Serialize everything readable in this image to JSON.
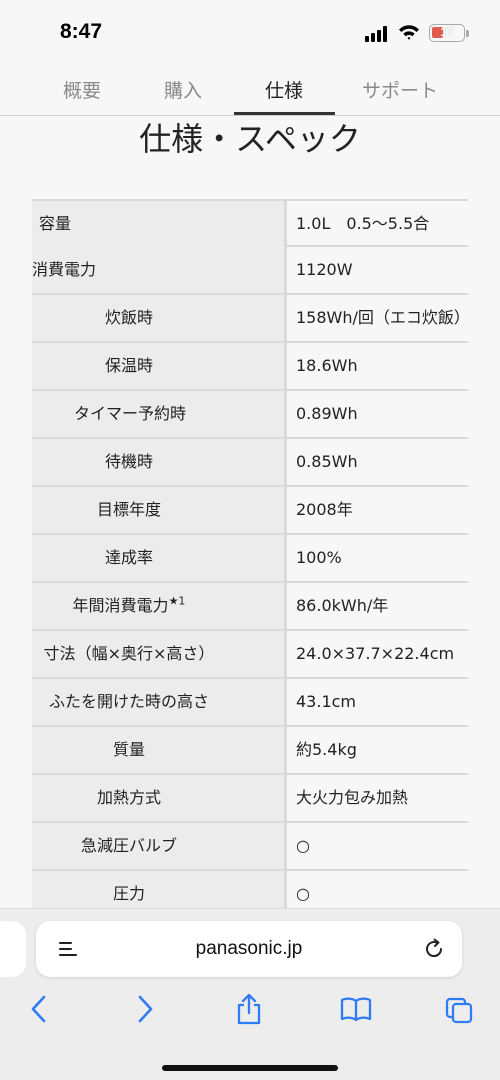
{
  "status_bar": {
    "time": "8:47",
    "battery": "17"
  },
  "tabs": [
    {
      "label": "概要",
      "active": false
    },
    {
      "label": "購入",
      "active": false
    },
    {
      "label": "仕様",
      "active": true
    },
    {
      "label": "サポート",
      "active": false
    }
  ],
  "page_title": "仕様・スペック",
  "spec_rows": [
    {
      "label": "容量",
      "value": "1.0L　0.5〜5.5合"
    },
    {
      "label": "消費電力",
      "value": "1120W"
    },
    {
      "label": "炊飯時",
      "value": "158Wh/回（エコ炊飯）"
    },
    {
      "label": "保温時",
      "value": "18.6Wh"
    },
    {
      "label": "タイマー予約時",
      "value": "0.89Wh"
    },
    {
      "label": "待機時",
      "value": "0.85Wh"
    },
    {
      "label": "目標年度",
      "value": "2008年"
    },
    {
      "label": "達成率",
      "value": "100%"
    },
    {
      "label": "年間消費電力",
      "note": "★1",
      "value": "86.0kWh/年"
    },
    {
      "label": "寸法（幅×奥行×高さ）",
      "value": "24.0×37.7×22.4cm"
    },
    {
      "label": "ふたを開けた時の高さ",
      "value": "43.1cm"
    },
    {
      "label": "質量",
      "value": "約5.4kg"
    },
    {
      "label": "加熱方式",
      "value": "大火力包み加熱"
    },
    {
      "label": "急減圧バルブ",
      "value": "○"
    },
    {
      "label": "圧力",
      "value": "○"
    }
  ],
  "browser": {
    "url": "panasonic.jp",
    "icons": {
      "reader": "reader-icon",
      "reload": "reload-icon",
      "back": "back-icon",
      "forward": "forward-icon",
      "share": "share-icon",
      "bookmarks": "bookmarks-icon",
      "tabs": "tabs-icon"
    }
  }
}
